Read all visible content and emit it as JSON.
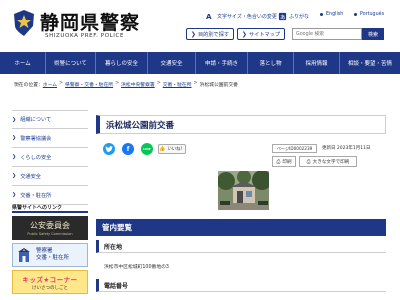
{
  "header": {
    "title": "静岡県警察",
    "subtitle": "SHIZUOKA PREF. POLICE",
    "utils": {
      "text_size": "文字サイズ・色合いの変更",
      "furigana": "ふりがな",
      "english": "English",
      "portuguese": "Português"
    },
    "purpose_search": "目的別で探す",
    "sitemap": "サイトマップ",
    "search": {
      "placeholder": "Google 検索",
      "button": "検索"
    }
  },
  "nav": [
    "ホーム",
    "県警について",
    "暮らしの安全",
    "交通安全",
    "申請・手続き",
    "落とし物",
    "採用情報",
    "相談・要望・苦情"
  ],
  "breadcrumb": {
    "prefix": "現在の位置：",
    "items": [
      "ホーム",
      "県警察・交番・駐在所",
      "浜松中央警察署",
      "交番・駐在所",
      "浜松城公園前交番"
    ]
  },
  "sidebar": {
    "items": [
      "組織について",
      "警察署協議会",
      "くらしの安全",
      "交通安全",
      "交番・駐在所"
    ],
    "links_heading": "県警サイトへのリンク",
    "banners": {
      "b1_title": "公安委員会",
      "b1_sub": "Public Safety Commission",
      "b2_line1": "警察署",
      "b2_line2": "交番・駐在所",
      "b3_title": "キッズ★コーナー",
      "b3_sub": "けいさつのしごと"
    }
  },
  "main": {
    "title": "浜松城公園前交番",
    "social": {
      "twitter": "t",
      "facebook": "f",
      "line": "LINE",
      "like": "いいね！"
    },
    "page_id": "ページID0002239",
    "updated": "更新日 2023年1月11日",
    "print": "印刷",
    "large_print": "大きな文字で印刷",
    "section": "管内要覧",
    "location_heading": "所在地",
    "location": "浜松市中区松城町100番地の3",
    "phone_heading": "電話番号"
  },
  "colors": {
    "brand": "#1f3787",
    "accent": "#e4356b"
  }
}
